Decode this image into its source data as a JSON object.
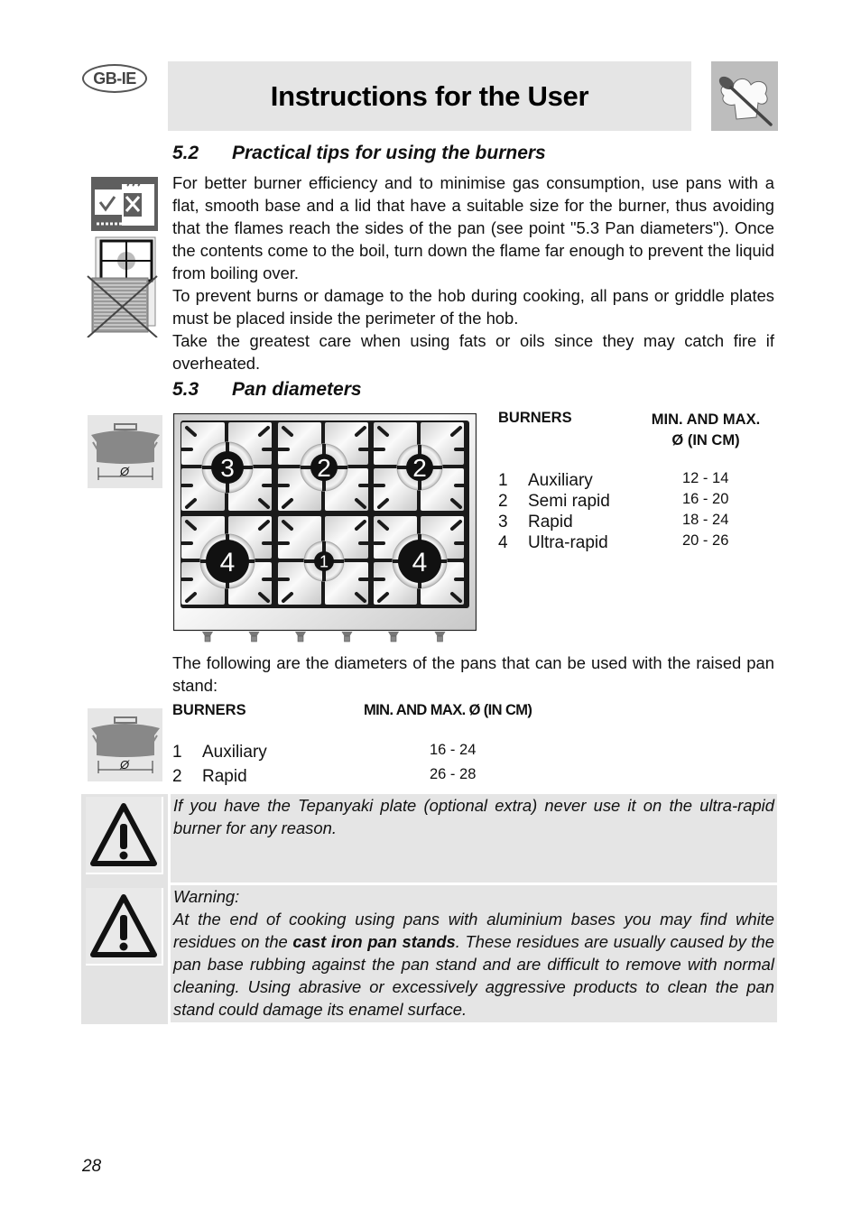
{
  "header": {
    "language_badge": "GB-IE",
    "title": "Instructions for the User",
    "chef_icon": "chef-hat-spoon-icon"
  },
  "section_5_2": {
    "number": "5.2",
    "title": "Practical tips for using the burners",
    "paragraphs": [
      "For better burner efficiency and to minimise gas consumption, use pans with a flat, smooth base and a lid that have a suitable size for the burner, thus avoiding that the flames reach the sides of the pan (see point \"5.3 Pan diameters\"). Once the contents come to the boil, turn down the flame far enough to prevent the liquid from boiling over.",
      "To prevent burns or damage to the hob during cooking, all pans or griddle plates must be placed inside the perimeter of the hob.",
      "Take the greatest care when using fats or oils since they may catch fire if overheated."
    ],
    "icons": [
      "pan-flame-check-icon",
      "griddle-plate-crossed-icon"
    ]
  },
  "section_5_3": {
    "number": "5.3",
    "title": "Pan diameters",
    "pan_icon_label": "Ø",
    "hob_diagram": {
      "burner_labels": [
        "3",
        "2",
        "2",
        "4",
        "1",
        "4"
      ],
      "knob_count": 6
    },
    "table": {
      "col_burners": "BURNERS",
      "col_diameter_line1": "MIN. AND MAX.",
      "col_diameter_line2": "Ø (IN CM)",
      "rows": [
        {
          "num": "1",
          "name": "Auxiliary",
          "range": "12 - 14"
        },
        {
          "num": "2",
          "name": "Semi rapid",
          "range": "16 - 20"
        },
        {
          "num": "3",
          "name": "Rapid",
          "range": "18 - 24"
        },
        {
          "num": "4",
          "name": "Ultra-rapid",
          "range": "20 - 26"
        }
      ]
    },
    "raised_stand_intro": "The following are the diameters of the pans that can be used with the raised pan stand:",
    "raised_table": {
      "col_burners": "BURNERS",
      "col_diameter": "MIN. AND MAX. Ø (IN CM)",
      "rows": [
        {
          "num": "1",
          "name": "Auxiliary",
          "range": "16 - 24"
        },
        {
          "num": "2",
          "name": "Rapid",
          "range": "26 - 28"
        }
      ]
    }
  },
  "warnings": [
    {
      "icon": "warning-triangle-icon",
      "text": "If you have the Tepanyaki plate (optional extra) never use it on the ultra-rapid burner for any reason."
    },
    {
      "icon": "warning-triangle-icon",
      "heading": "Warning:",
      "text_before_bold": "At the end of cooking using pans with aluminium bases you may find white residues on the ",
      "bold": "cast iron pan stands",
      "text_after_bold": ". These residues are usually caused by the pan base rubbing against the pan stand and are difficult to remove with normal cleaning. Using abrasive or excessively aggressive products to clean the pan stand could damage its enamel surface."
    }
  ],
  "footer": {
    "page_number": "28"
  }
}
